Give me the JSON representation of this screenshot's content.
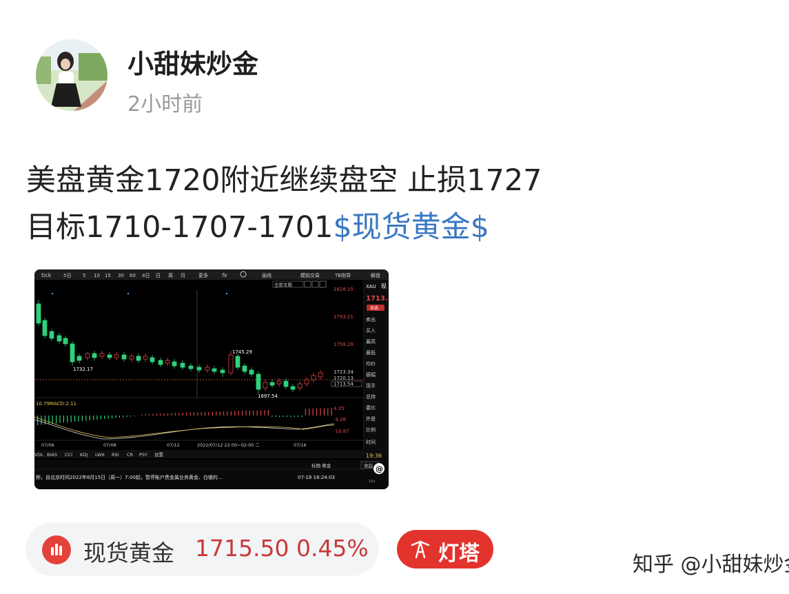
{
  "post": {
    "author": "小甜妹炒金",
    "time": "2小时前",
    "text_line1": "美盘黄金1720附近继续盘空 止损1727",
    "text_line2_plain": "目标1710-1707-1701",
    "text_line2_topic": "$现货黄金$"
  },
  "chart_shot": {
    "toolbar": [
      "tick",
      "5日",
      "5",
      "10",
      "15",
      "30",
      "60",
      "4日",
      "日",
      "周",
      "月",
      "更多",
      "fx",
      "画线",
      "模拟交易",
      "TB指导",
      "解盘"
    ],
    "dropdown": "全部主图",
    "price_labels": [
      "1828.15",
      "1793.21",
      "1758.28",
      "1723.34",
      "1720.13",
      "1713.54"
    ],
    "point_labels": [
      "1745.29",
      "1732.17",
      "1697.54"
    ],
    "macd_label": "10.79",
    "macd_name": "MACD:2.11",
    "macd_levels": [
      "4.35",
      "-3.26",
      "-10.87"
    ],
    "dates": [
      "07/06",
      "07/08",
      "07/12",
      "2022/07/12 22:00~02:00 二",
      "07/16"
    ],
    "indicator_tabs": [
      "VOL",
      "BIAS",
      "CCI",
      "KDJ",
      "LW6",
      "RSI",
      "CR",
      "PSY",
      "设置"
    ],
    "right_panel": {
      "symbol": "XAU",
      "symbol_cn": "现",
      "price": "1713.",
      "badge": "自选",
      "labels": [
        "卖出",
        "买入",
        "最高",
        "最低",
        "均价",
        "振幅",
        "现手",
        "总持",
        "委比",
        "外盘",
        "比例",
        "时间"
      ],
      "clock": "19:36",
      "speed": ".18s"
    },
    "news_header": "标题:黄金",
    "news_button": "收起",
    "news_text": "称，自北京时间2022年8月15日（周一）7:00起，暂停账户贵金属业务黄金、白银的...",
    "news_time": "07-18 18:24:03"
  },
  "quote": {
    "name": "现货黄金",
    "price_change": "1715.50 0.45%",
    "up_color": "#c7393a"
  },
  "lighthouse": {
    "label": "灯塔",
    "color": "#e3332d"
  },
  "watermark": "知乎 @小甜妹炒金"
}
